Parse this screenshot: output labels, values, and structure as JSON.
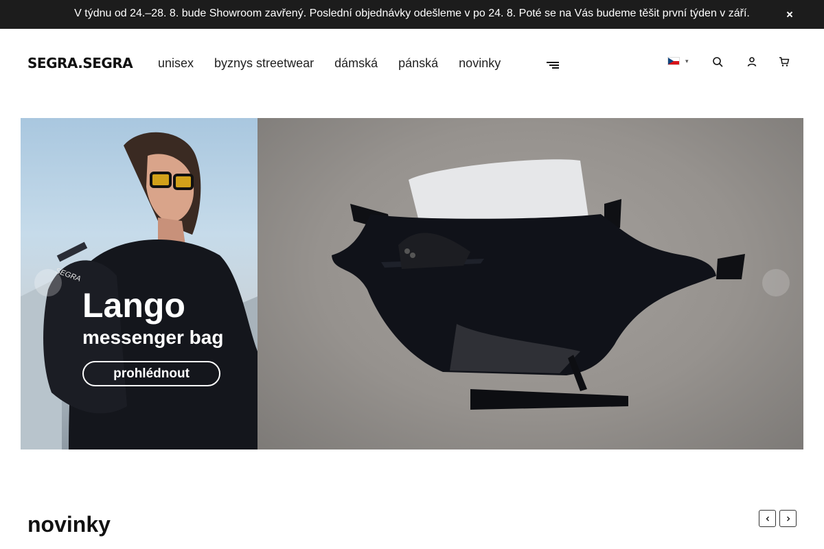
{
  "announcement": {
    "text": "V týdnu od 24.–28. 8. bude Showroom zavřený. Poslední objednávky odešleme v po 24. 8. Poté se na Vás budeme těšit první týden v září."
  },
  "header": {
    "logo": "SEGRA.SEGRA",
    "nav": [
      "unisex",
      "byznys streetwear",
      "dámská",
      "pánská",
      "novinky"
    ],
    "icons": [
      "menu-icon",
      "czech-flag",
      "search-icon",
      "user-icon",
      "cart-icon"
    ]
  },
  "hero": {
    "title": "Lango",
    "subtitle": "messenger bag",
    "cta": "prohlédnout"
  },
  "section": {
    "title": "novinky"
  },
  "colors": {
    "announcement_bg": "#1c1c1c",
    "text": "#111111",
    "flag_red": "#d7141a",
    "flag_blue": "#11457e"
  }
}
